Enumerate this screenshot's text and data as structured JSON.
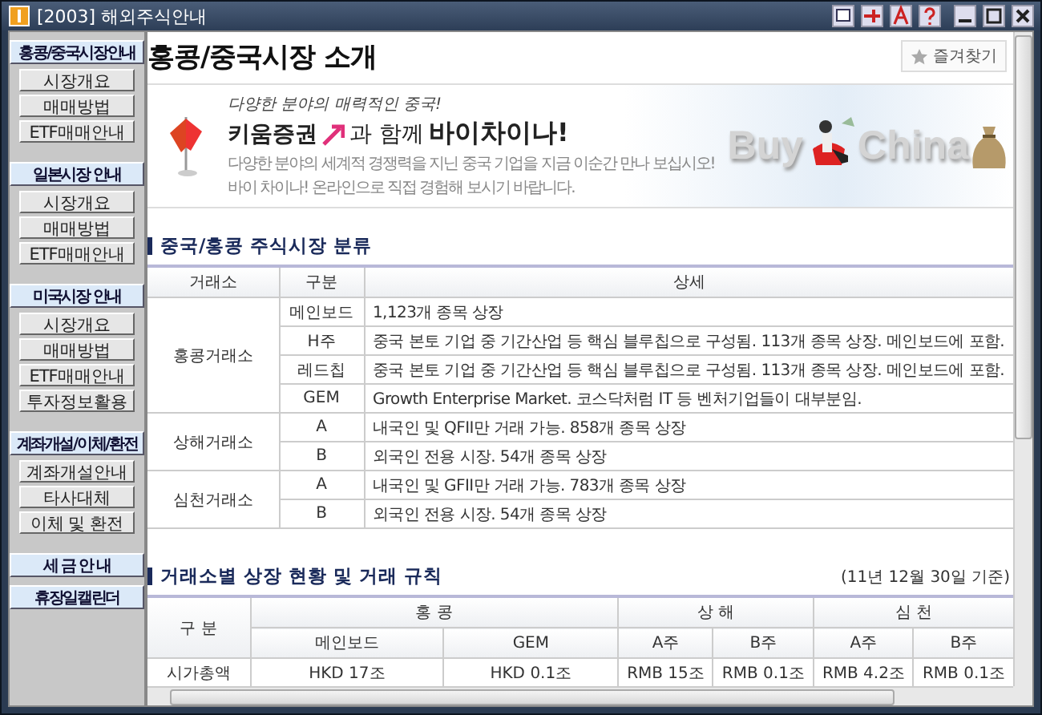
{
  "window": {
    "title": "[2003] 해외주식안내"
  },
  "sidebar": {
    "groups": [
      {
        "label": "홍콩/중국시장안내",
        "items": [
          "시장개요",
          "매매방법",
          "ETF매매안내"
        ]
      },
      {
        "label": "일본시장 안내",
        "items": [
          "시장개요",
          "매매방법",
          "ETF매매안내"
        ]
      },
      {
        "label": "미국시장 안내",
        "items": [
          "시장개요",
          "매매방법",
          "ETF매매안내",
          "투자정보활용"
        ]
      },
      {
        "label": "계좌개설/이체/환전",
        "items": [
          "계좌개설안내",
          "타사대체",
          "이체 및 환전"
        ]
      },
      {
        "label": "세 금 안 내"
      },
      {
        "label": "휴장일캘린더"
      }
    ]
  },
  "page": {
    "title": "홍콩/중국시장 소개",
    "favorite": "즐겨찾기"
  },
  "banner": {
    "tagline": "다양한 분야의 매력적인 중국!",
    "brand": "키움증권",
    "headline_mid": "과 함께",
    "headline_end": "바이차이나!",
    "description": [
      "다양한 분야의 세계적 경쟁력을 지닌 중국 기업을 지금 이순간 만나 보십시오!",
      "바이 차이나! 온라인으로 직접 경험해 보시기 바랍니다."
    ],
    "logo_words": [
      "Buy",
      "China"
    ]
  },
  "section1": {
    "heading": "중국/홍콩 주식시장 분류",
    "columns": [
      "거래소",
      "구분",
      "상세"
    ],
    "groups": [
      {
        "exchange": "홍콩거래소",
        "rows": [
          {
            "type": "메인보드",
            "detail": "1,123개 종목 상장"
          },
          {
            "type": "H주",
            "detail": "중국 본토 기업 중 기간산업 등 핵심 블루칩으로 구성됨. 113개 종목 상장. 메인보드에 포함."
          },
          {
            "type": "레드칩",
            "detail": "중국 본토 기업 중 기간산업 등 핵심 블루칩으로 구성됨. 113개 종목 상장. 메인보드에 포함."
          },
          {
            "type": "GEM",
            "detail": "Growth Enterprise Market. 코스닥처럼 IT 등 벤처기업들이 대부분임."
          }
        ]
      },
      {
        "exchange": "상해거래소",
        "rows": [
          {
            "type": "A",
            "detail": "내국인 및 QFII만 거래 가능. 858개 종목 상장"
          },
          {
            "type": "B",
            "detail": "외국인 전용 시장. 54개 종목 상장"
          }
        ]
      },
      {
        "exchange": "심천거래소",
        "rows": [
          {
            "type": "A",
            "detail": "내국인 및 GFII만 거래 가능. 783개 종목 상장"
          },
          {
            "type": "B",
            "detail": "외국인 전용 시장. 54개 종목 상장"
          }
        ]
      }
    ]
  },
  "section2": {
    "heading": "거래소별 상장 현황 및 거래 규칙",
    "note": "(11년 12월 30일 기준)",
    "row_header": "구 분",
    "header_groups": [
      {
        "label": "홍 콩",
        "columns": [
          "메인보드",
          "GEM"
        ]
      },
      {
        "label": "상 해",
        "columns": [
          "A주",
          "B주"
        ]
      },
      {
        "label": "심 천",
        "columns": [
          "A주",
          "B주"
        ]
      }
    ],
    "rows": [
      {
        "label": "시가총액",
        "cells": [
          "HKD 17조",
          "HKD 0.1조",
          "RMB 15조",
          "RMB 0.1조",
          "RMB 4.2조",
          "RMB 0.1조"
        ]
      }
    ]
  }
}
